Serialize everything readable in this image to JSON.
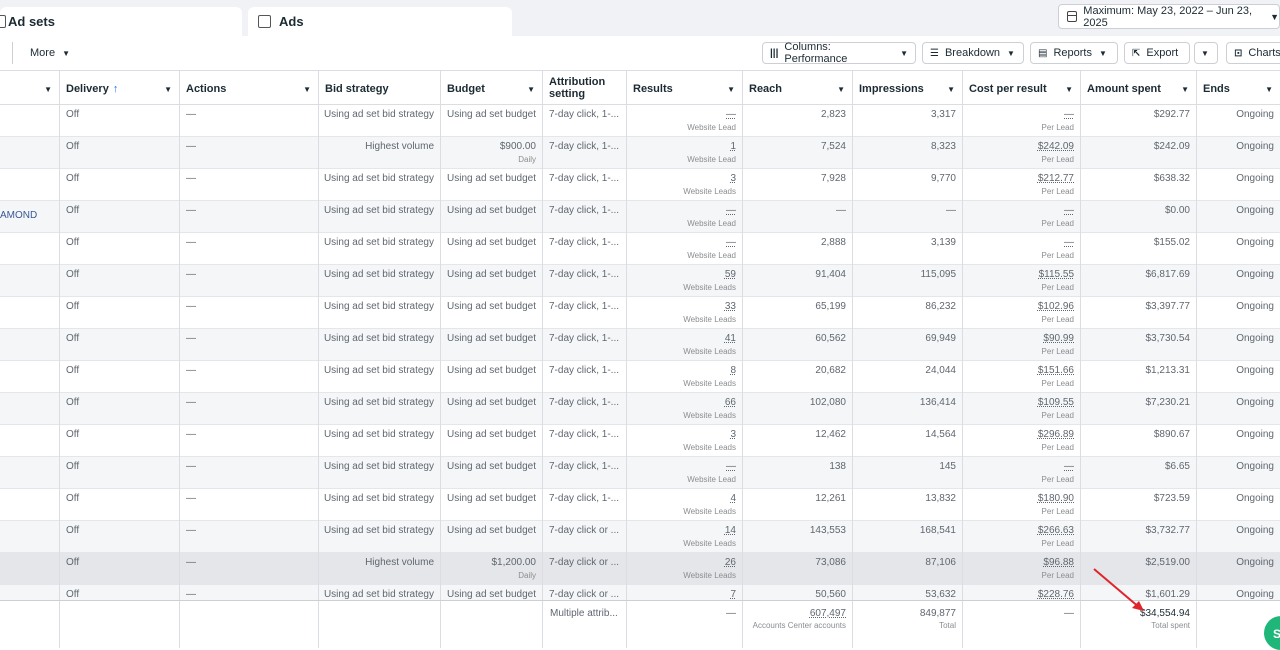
{
  "tabs": {
    "adsets": "Ad sets",
    "ads": "Ads"
  },
  "date_range": "Maximum: May 23, 2022 – Jun 23, 2025",
  "toolbar": {
    "more": "More",
    "columns": "Columns: Performance",
    "breakdown": "Breakdown",
    "reports": "Reports",
    "export": "Export",
    "charts": "Charts"
  },
  "headers": {
    "delivery": "Delivery",
    "actions": "Actions",
    "bid_strategy": "Bid strategy",
    "budget": "Budget",
    "attribution_l1": "Attribution",
    "attribution_l2": "setting",
    "results": "Results",
    "reach": "Reach",
    "impressions": "Impressions",
    "cost_per_result": "Cost per result",
    "amount_spent": "Amount spent",
    "ends": "Ends"
  },
  "rows": [
    {
      "name": "",
      "delivery": "Off",
      "actions": "—",
      "bid": "Using ad set bid strategy",
      "budget": "Using ad set budget",
      "budget_sub": "",
      "attr": "7-day click, 1-...",
      "results": "—",
      "results_sub": "Website Lead",
      "reach": "2,823",
      "impr": "3,317",
      "cpr": "—",
      "cpr_sub": "Per Lead",
      "spent": "$292.77",
      "ends": "Ongoing"
    },
    {
      "name": "",
      "delivery": "Off",
      "actions": "—",
      "bid": "Highest volume",
      "budget": "$900.00",
      "budget_sub": "Daily",
      "attr": "7-day click, 1-...",
      "results": "1",
      "results_sub": "Website Lead",
      "reach": "7,524",
      "impr": "8,323",
      "cpr": "$242.09",
      "cpr_sub": "Per Lead",
      "spent": "$242.09",
      "ends": "Ongoing"
    },
    {
      "name": "",
      "delivery": "Off",
      "actions": "—",
      "bid": "Using ad set bid strategy",
      "budget": "Using ad set budget",
      "budget_sub": "",
      "attr": "7-day click, 1-...",
      "results": "3",
      "results_sub": "Website Leads",
      "reach": "7,928",
      "impr": "9,770",
      "cpr": "$212.77",
      "cpr_sub": "Per Lead",
      "spent": "$638.32",
      "ends": "Ongoing"
    },
    {
      "name": "AMOND",
      "delivery": "Off",
      "actions": "—",
      "bid": "Using ad set bid strategy",
      "budget": "Using ad set budget",
      "budget_sub": "",
      "attr": "7-day click, 1-...",
      "results": "—",
      "results_sub": "Website Lead",
      "reach": "—",
      "impr": "—",
      "cpr": "—",
      "cpr_sub": "Per Lead",
      "spent": "$0.00",
      "ends": "Ongoing"
    },
    {
      "name": "",
      "delivery": "Off",
      "actions": "—",
      "bid": "Using ad set bid strategy",
      "budget": "Using ad set budget",
      "budget_sub": "",
      "attr": "7-day click, 1-...",
      "results": "—",
      "results_sub": "Website Lead",
      "reach": "2,888",
      "impr": "3,139",
      "cpr": "—",
      "cpr_sub": "Per Lead",
      "spent": "$155.02",
      "ends": "Ongoing"
    },
    {
      "name": "",
      "delivery": "Off",
      "actions": "—",
      "bid": "Using ad set bid strategy",
      "budget": "Using ad set budget",
      "budget_sub": "",
      "attr": "7-day click, 1-...",
      "results": "59",
      "results_sub": "Website Leads",
      "reach": "91,404",
      "impr": "115,095",
      "cpr": "$115.55",
      "cpr_sub": "Per Lead",
      "spent": "$6,817.69",
      "ends": "Ongoing"
    },
    {
      "name": "",
      "delivery": "Off",
      "actions": "—",
      "bid": "Using ad set bid strategy",
      "budget": "Using ad set budget",
      "budget_sub": "",
      "attr": "7-day click, 1-...",
      "results": "33",
      "results_sub": "Website Leads",
      "reach": "65,199",
      "impr": "86,232",
      "cpr": "$102.96",
      "cpr_sub": "Per Lead",
      "spent": "$3,397.77",
      "ends": "Ongoing"
    },
    {
      "name": "",
      "delivery": "Off",
      "actions": "—",
      "bid": "Using ad set bid strategy",
      "budget": "Using ad set budget",
      "budget_sub": "",
      "attr": "7-day click, 1-...",
      "results": "41",
      "results_sub": "Website Leads",
      "reach": "60,562",
      "impr": "69,949",
      "cpr": "$90.99",
      "cpr_sub": "Per Lead",
      "spent": "$3,730.54",
      "ends": "Ongoing"
    },
    {
      "name": "",
      "delivery": "Off",
      "actions": "—",
      "bid": "Using ad set bid strategy",
      "budget": "Using ad set budget",
      "budget_sub": "",
      "attr": "7-day click, 1-...",
      "results": "8",
      "results_sub": "Website Leads",
      "reach": "20,682",
      "impr": "24,044",
      "cpr": "$151.66",
      "cpr_sub": "Per Lead",
      "spent": "$1,213.31",
      "ends": "Ongoing"
    },
    {
      "name": "",
      "delivery": "Off",
      "actions": "—",
      "bid": "Using ad set bid strategy",
      "budget": "Using ad set budget",
      "budget_sub": "",
      "attr": "7-day click, 1-...",
      "results": "66",
      "results_sub": "Website Leads",
      "reach": "102,080",
      "impr": "136,414",
      "cpr": "$109.55",
      "cpr_sub": "Per Lead",
      "spent": "$7,230.21",
      "ends": "Ongoing"
    },
    {
      "name": "",
      "delivery": "Off",
      "actions": "—",
      "bid": "Using ad set bid strategy",
      "budget": "Using ad set budget",
      "budget_sub": "",
      "attr": "7-day click, 1-...",
      "results": "3",
      "results_sub": "Website Leads",
      "reach": "12,462",
      "impr": "14,564",
      "cpr": "$296.89",
      "cpr_sub": "Per Lead",
      "spent": "$890.67",
      "ends": "Ongoing"
    },
    {
      "name": "",
      "delivery": "Off",
      "actions": "—",
      "bid": "Using ad set bid strategy",
      "budget": "Using ad set budget",
      "budget_sub": "",
      "attr": "7-day click, 1-...",
      "results": "—",
      "results_sub": "Website Lead",
      "reach": "138",
      "impr": "145",
      "cpr": "—",
      "cpr_sub": "Per Lead",
      "spent": "$6.65",
      "ends": "Ongoing"
    },
    {
      "name": "",
      "delivery": "Off",
      "actions": "—",
      "bid": "Using ad set bid strategy",
      "budget": "Using ad set budget",
      "budget_sub": "",
      "attr": "7-day click, 1-...",
      "results": "4",
      "results_sub": "Website Leads",
      "reach": "12,261",
      "impr": "13,832",
      "cpr": "$180.90",
      "cpr_sub": "Per Lead",
      "spent": "$723.59",
      "ends": "Ongoing"
    },
    {
      "name": "",
      "delivery": "Off",
      "actions": "—",
      "bid": "Using ad set bid strategy",
      "budget": "Using ad set budget",
      "budget_sub": "",
      "attr": "7-day click or ...",
      "results": "14",
      "results_sub": "Website Leads",
      "reach": "143,553",
      "impr": "168,541",
      "cpr": "$266.63",
      "cpr_sub": "Per Lead",
      "spent": "$3,732.77",
      "ends": "Ongoing"
    },
    {
      "name": "",
      "delivery": "Off",
      "actions": "—",
      "bid": "Highest volume",
      "budget": "$1,200.00",
      "budget_sub": "Daily",
      "attr": "7-day click or ...",
      "results": "26",
      "results_sub": "Website Leads",
      "reach": "73,086",
      "impr": "87,106",
      "cpr": "$96.88",
      "cpr_sub": "Per Lead",
      "spent": "$2,519.00",
      "ends": "Ongoing"
    },
    {
      "name": "",
      "delivery": "Off",
      "actions": "—",
      "bid": "Using ad set bid strategy",
      "budget": "Using ad set budget",
      "budget_sub": "",
      "attr": "7-day click or ...",
      "results": "7",
      "results_sub": "",
      "reach": "50,560",
      "impr": "53,632",
      "cpr": "$228.76",
      "cpr_sub": "",
      "spent": "$1,601.29",
      "ends": "Ongoing"
    }
  ],
  "totals": {
    "attr": "Multiple attrib...",
    "results": "—",
    "reach": "607,497",
    "reach_sub": "Accounts Center accounts",
    "impr": "849,877",
    "impr_sub": "Total",
    "cpr": "—",
    "spent": "$34,554.94",
    "spent_sub": "Total spent"
  },
  "colors": {
    "accent": "#1877f2",
    "arrow": "#e0242b",
    "fab": "#1fb67a"
  }
}
